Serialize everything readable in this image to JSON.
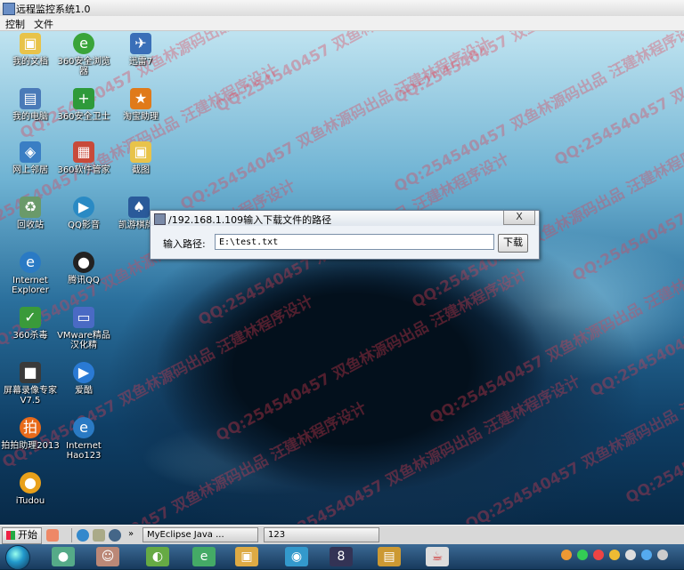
{
  "window": {
    "title": "远程监控系统1.0"
  },
  "menu": [
    "控制",
    "文件"
  ],
  "desktop_icons": [
    {
      "label": "我的文档",
      "icon": "folder-icon",
      "color": "#e8c34a"
    },
    {
      "label": "360安全浏览器",
      "icon": "browser-icon",
      "color": "#3aa43a"
    },
    {
      "label": "迅雷7",
      "icon": "bird-icon",
      "color": "#3a6fb8"
    },
    {
      "label": "我的电脑",
      "icon": "computer-icon",
      "color": "#4a7ab8"
    },
    {
      "label": "360安全卫士",
      "icon": "shield-plus-icon",
      "color": "#2e9a3a"
    },
    {
      "label": "淘宝助理",
      "icon": "helper-icon",
      "color": "#e07a1a"
    },
    {
      "label": "网上邻居",
      "icon": "network-icon",
      "color": "#3a7ec4"
    },
    {
      "label": "360软件管家",
      "icon": "apps-icon",
      "color": "#c84a3a"
    },
    {
      "label": "截图",
      "icon": "folder-icon",
      "color": "#e8c34a"
    },
    {
      "label": "回收站",
      "icon": "recycle-bin-icon",
      "color": "#6a9a6a"
    },
    {
      "label": "QQ影音",
      "icon": "media-icon",
      "color": "#2a8ac4"
    },
    {
      "label": "凯游棋牌3",
      "icon": "game-icon",
      "color": "#2a5a9a"
    },
    {
      "label": "Internet Explorer",
      "icon": "ie-icon",
      "color": "#2a7ac4"
    },
    {
      "label": "腾讯QQ",
      "icon": "qq-penguin-icon",
      "color": "#222222"
    },
    {
      "label": "360杀毒",
      "icon": "antivirus-icon",
      "color": "#3a9a3a"
    },
    {
      "label": "VMware精品汉化精",
      "icon": "vmware-icon",
      "color": "#4a6ac4"
    },
    {
      "label": "屏幕录像专家V7.5",
      "icon": "recorder-icon",
      "color": "#3a3a3a"
    },
    {
      "label": "爱酷",
      "icon": "video-icon",
      "color": "#2a7ad4"
    },
    {
      "label": "拍拍助理2013",
      "icon": "paipai-icon",
      "color": "#e86a1a"
    },
    {
      "label": "Internet Hao123",
      "icon": "ie-icon",
      "color": "#2a7ac4"
    },
    {
      "label": "iTudou",
      "icon": "tudou-icon",
      "color": "#e8a01a"
    }
  ],
  "watermark_text": "QQ:254540457 双鱼林源码出品 汪建林程序设计",
  "dialog": {
    "title": "/192.168.1.109输入下载文件的路径",
    "close": "X",
    "field_label": "输入路径:",
    "field_value": "E:\\test.txt",
    "button": "下载"
  },
  "taskbar": {
    "start": "开始",
    "items": [
      "MyEclipse Java ...",
      "123"
    ]
  }
}
